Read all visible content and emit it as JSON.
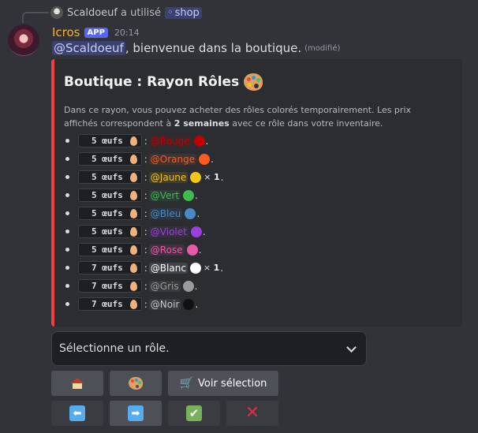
{
  "reply": {
    "username": "Scaldoeuf",
    "action": "a utilisé",
    "command": "shop"
  },
  "message": {
    "author": "Icros",
    "badge": "APP",
    "time": "20:14",
    "mention": "@Scaldoeuf",
    "text": ", bienvenue dans la boutique.",
    "edited": "(modifié)"
  },
  "embed": {
    "accent_color": "#f23f42",
    "title": "Boutique : Rayon Rôles",
    "desc_part1": "Dans ce rayon, vous pouvez acheter des rôles colorés temporairement. Les prix affichés correspondent à ",
    "desc_bold": "2 semaines",
    "desc_part2": " avec ce rôle dans votre inventaire.",
    "roles": [
      {
        "price": "5 œufs",
        "name": "@Rouge",
        "color": "#c00000",
        "mult": ""
      },
      {
        "price": "5 œufs",
        "name": "@Orange",
        "color": "#ff5a1f",
        "mult": ""
      },
      {
        "price": "5 œufs",
        "name": "@Jaune",
        "color": "#f5c518",
        "mult": "1"
      },
      {
        "price": "5 œufs",
        "name": "@Vert",
        "color": "#3fba4f",
        "mult": ""
      },
      {
        "price": "5 œufs",
        "name": "@Bleu",
        "color": "#4a89c8",
        "mult": ""
      },
      {
        "price": "5 œufs",
        "name": "@Violet",
        "color": "#9b3fdc",
        "mult": ""
      },
      {
        "price": "5 œufs",
        "name": "@Rose",
        "color": "#e85aa8",
        "mult": ""
      },
      {
        "price": "7 œufs",
        "name": "@Blanc",
        "color": "#ffffff",
        "mult": "1"
      },
      {
        "price": "7 œufs",
        "name": "@Gris",
        "color": "#9a9a9a",
        "mult": ""
      },
      {
        "price": "7 œufs",
        "name": "@Noir",
        "color": "#111111",
        "mult": ""
      }
    ]
  },
  "select": {
    "placeholder": "Sélectionne un rôle."
  },
  "buttons": {
    "home_icon": "house-icon",
    "palette_icon": "palette-icon",
    "view_selection": "Voir sélection",
    "prev_icon": "left-arrow-icon",
    "next_icon": "right-arrow-icon",
    "confirm_icon": "check-icon",
    "cancel_icon": "cross-icon"
  }
}
